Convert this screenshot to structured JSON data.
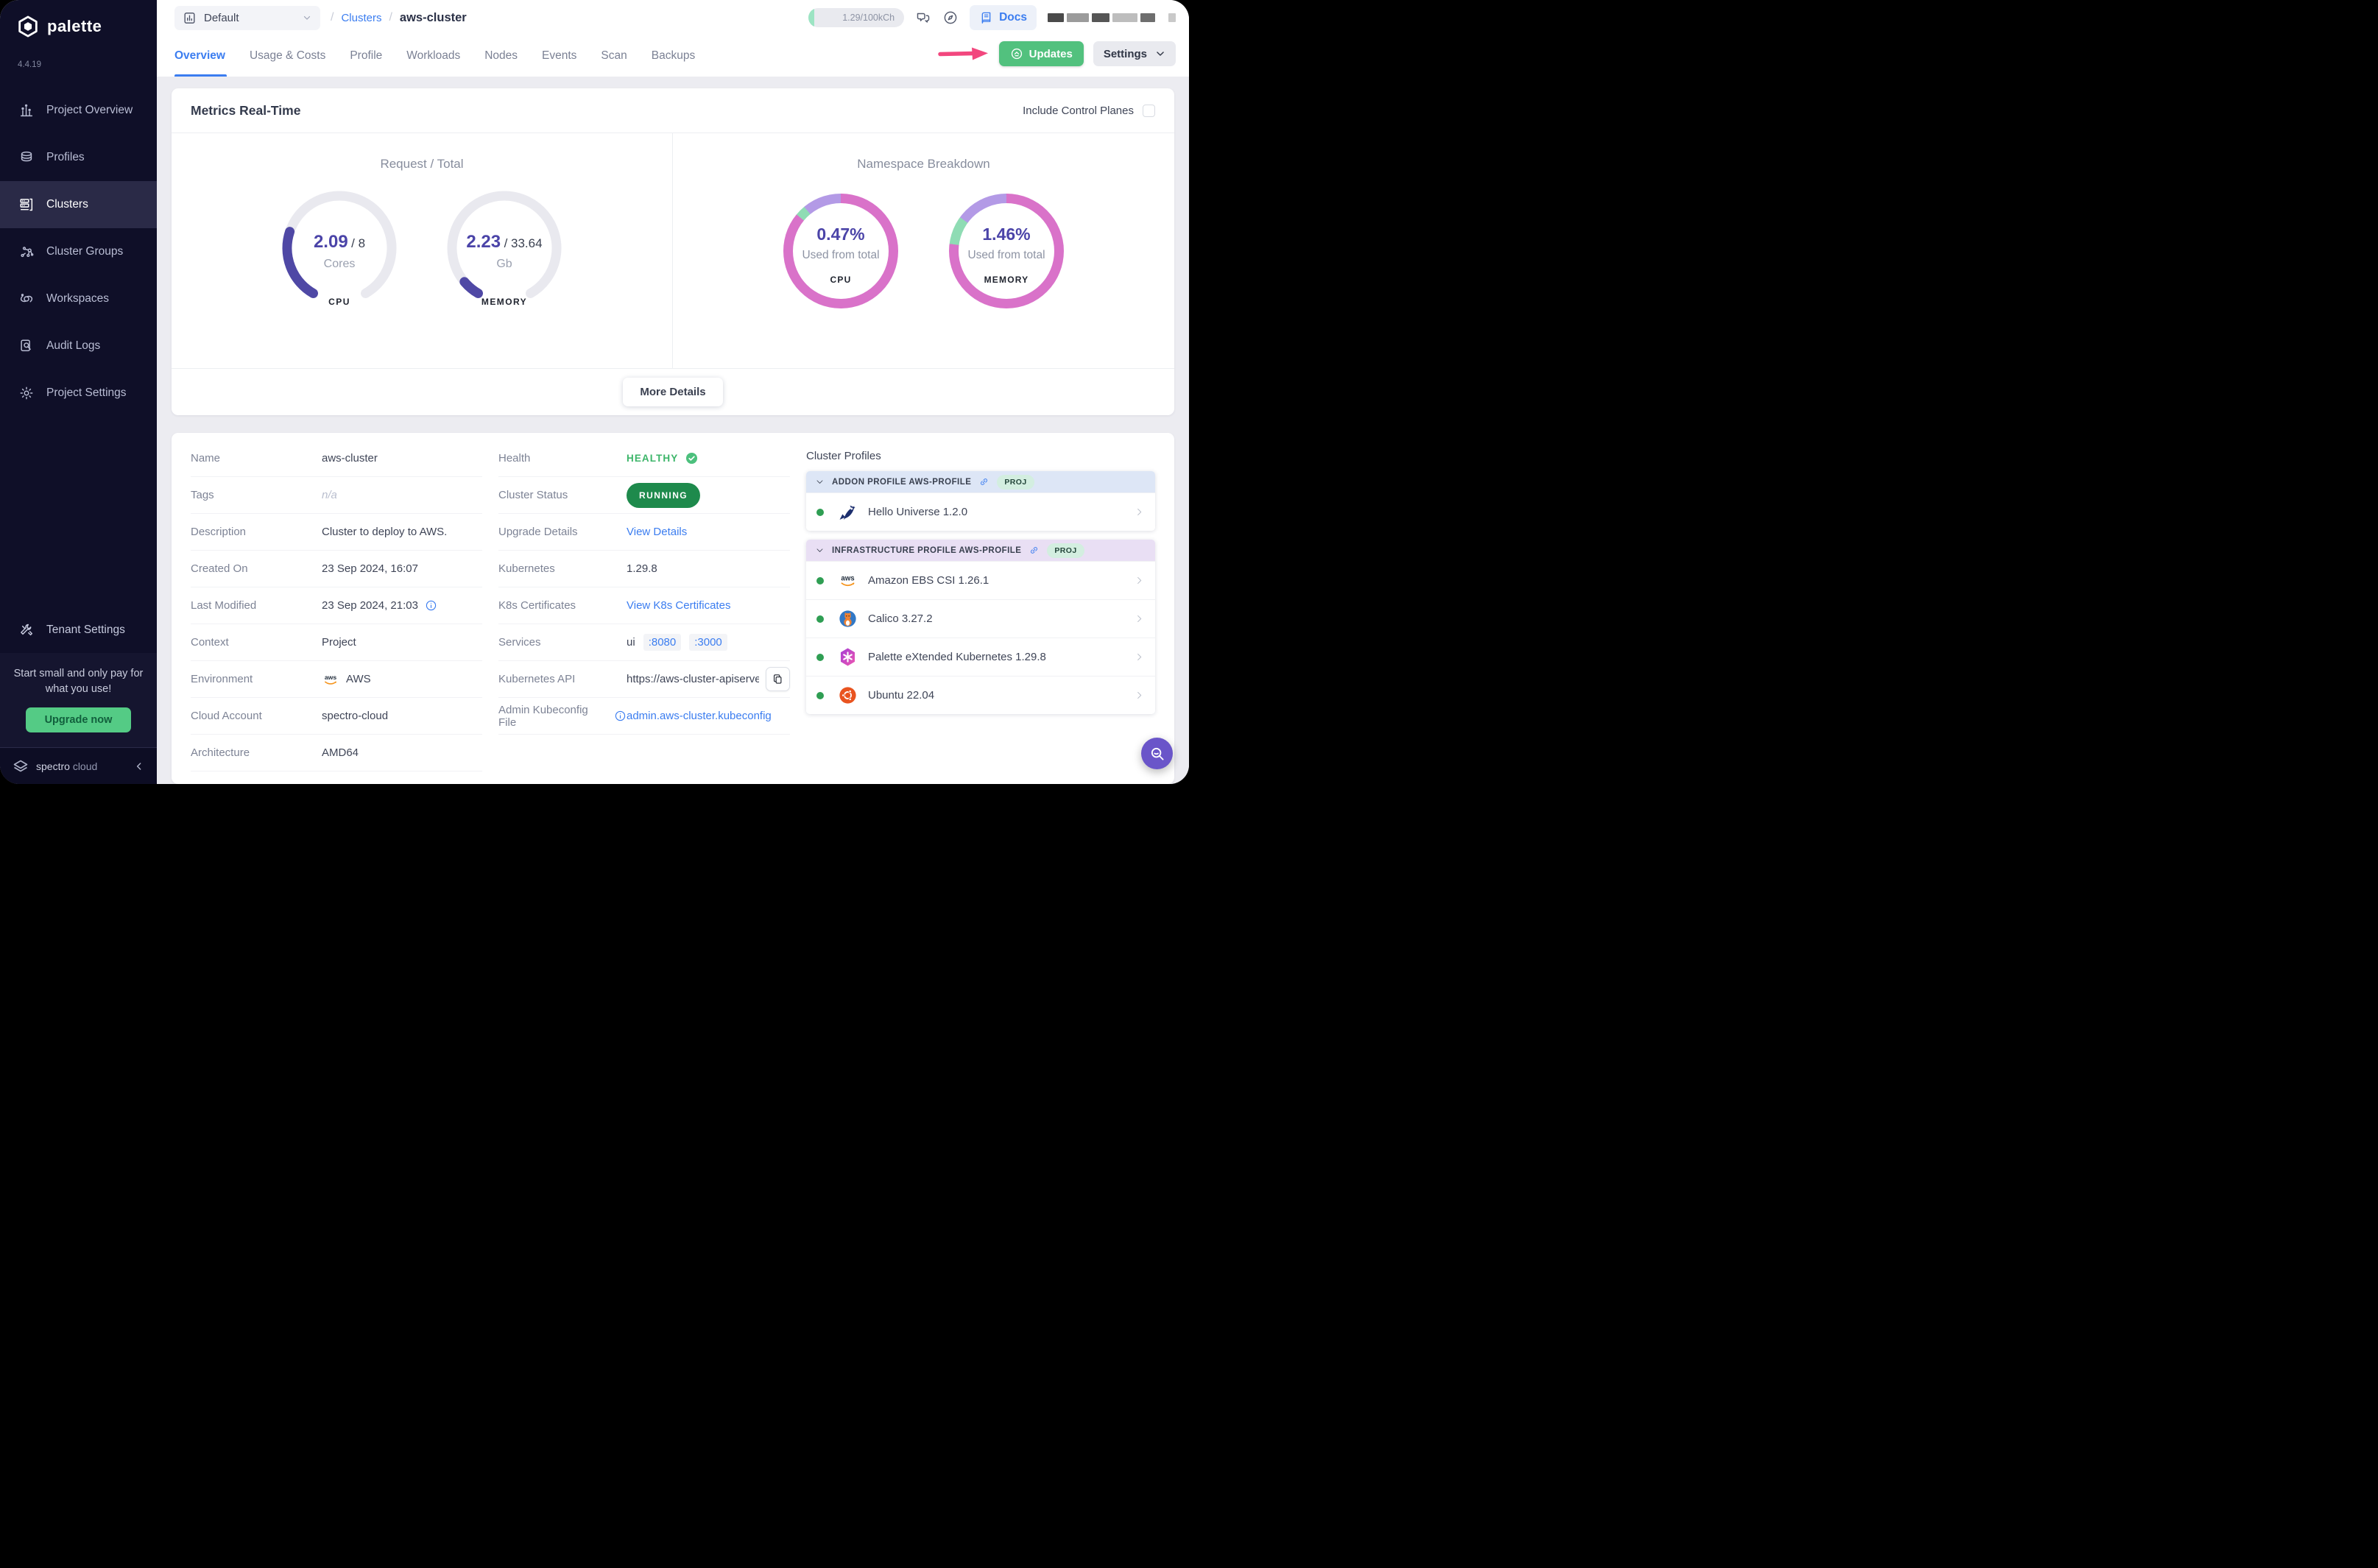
{
  "app": {
    "brand": "palette",
    "version": "4.4.19"
  },
  "sidebar": {
    "items": [
      {
        "label": "Project Overview",
        "icon": "chart-overview",
        "active": false
      },
      {
        "label": "Profiles",
        "icon": "layers",
        "active": false
      },
      {
        "label": "Clusters",
        "icon": "servers",
        "active": true
      },
      {
        "label": "Cluster Groups",
        "icon": "network",
        "active": false
      },
      {
        "label": "Workspaces",
        "icon": "orbit",
        "active": false
      },
      {
        "label": "Audit Logs",
        "icon": "audit",
        "active": false
      },
      {
        "label": "Project Settings",
        "icon": "gear",
        "active": false
      }
    ],
    "tenant_settings_label": "Tenant Settings",
    "promo": {
      "text": "Start small and only pay for what you use!",
      "button_label": "Upgrade now"
    },
    "footer": {
      "brand_strong": "spectro",
      "brand_light": "cloud"
    }
  },
  "topbar": {
    "project_selector_label": "Default",
    "breadcrumb": [
      {
        "label": "Clusters",
        "link": true
      },
      {
        "label": "aws-cluster",
        "link": false
      }
    ],
    "usage_pill": "1.29/100kCh",
    "docs_label": "Docs"
  },
  "tabs": [
    {
      "label": "Overview",
      "active": true
    },
    {
      "label": "Usage & Costs",
      "active": false
    },
    {
      "label": "Profile",
      "active": false
    },
    {
      "label": "Workloads",
      "active": false
    },
    {
      "label": "Nodes",
      "active": false
    },
    {
      "label": "Events",
      "active": false
    },
    {
      "label": "Scan",
      "active": false
    },
    {
      "label": "Backups",
      "active": false
    }
  ],
  "header_actions": {
    "updates_label": "Updates",
    "settings_label": "Settings"
  },
  "metrics": {
    "title": "Metrics Real-Time",
    "include_control_planes_label": "Include Control Planes",
    "gauge_color": "#4f48a5",
    "gauge_track": "#e9e9ef",
    "request_total": {
      "title": "Request / Total",
      "gauges": [
        {
          "value": "2.09",
          "total": "8",
          "unit": "Cores",
          "label": "CPU",
          "fraction": 0.261
        },
        {
          "value": "2.23",
          "total": "33.64",
          "unit": "Gb",
          "label": "MEMORY",
          "fraction": 0.066
        }
      ]
    },
    "namespace_breakdown": {
      "title": "Namespace Breakdown",
      "donuts": [
        {
          "value": "0.47%",
          "caption": "Used from total",
          "label": "CPU",
          "segments": [
            {
              "color": "#d972c9",
              "pct": 86
            },
            {
              "color": "#8fdcb4",
              "pct": 3
            },
            {
              "color": "#b39ae6",
              "pct": 11
            }
          ]
        },
        {
          "value": "1.46%",
          "caption": "Used from total",
          "label": "MEMORY",
          "segments": [
            {
              "color": "#d972c9",
              "pct": 77
            },
            {
              "color": "#8fdcb4",
              "pct": 8
            },
            {
              "color": "#b39ae6",
              "pct": 15
            }
          ]
        }
      ]
    },
    "more_details_label": "More Details"
  },
  "details": {
    "left": [
      {
        "label": "Name",
        "type": "text",
        "value": "aws-cluster"
      },
      {
        "label": "Tags",
        "type": "muted",
        "value": "n/a"
      },
      {
        "label": "Description",
        "type": "text",
        "value": "Cluster to deploy to AWS."
      },
      {
        "label": "Created On",
        "type": "text",
        "value": "23 Sep 2024, 16:07"
      },
      {
        "label": "Last Modified",
        "type": "text-info",
        "value": "23 Sep 2024, 21:03"
      },
      {
        "label": "Context",
        "type": "text",
        "value": "Project"
      },
      {
        "label": "Environment",
        "type": "aws",
        "value": "AWS"
      },
      {
        "label": "Cloud Account",
        "type": "text",
        "value": "spectro-cloud"
      },
      {
        "label": "Architecture",
        "type": "text",
        "value": "AMD64"
      }
    ],
    "mid": [
      {
        "label": "Health",
        "type": "health",
        "value": "HEALTHY"
      },
      {
        "label": "Cluster Status",
        "type": "badge",
        "value": "RUNNING"
      },
      {
        "label": "Upgrade Details",
        "type": "link",
        "value": "View Details"
      },
      {
        "label": "Kubernetes",
        "type": "text",
        "value": "1.29.8"
      },
      {
        "label": "K8s Certificates",
        "type": "link",
        "value": "View K8s Certificates"
      },
      {
        "label": "Services",
        "type": "services",
        "value": "ui",
        "ports": [
          ":8080",
          ":3000"
        ]
      },
      {
        "label": "Kubernetes API",
        "type": "copy",
        "value": "https://aws-cluster-apiserve..."
      },
      {
        "label": "Admin Kubeconfig File",
        "type": "link",
        "label_info": true,
        "value": "admin.aws-cluster.kubeconfig"
      }
    ]
  },
  "profiles": {
    "heading": "Cluster Profiles",
    "groups": [
      {
        "title": "ADDON PROFILE AWS-PROFILE",
        "badge": "PROJ",
        "tint": "blue",
        "items": [
          {
            "name": "Hello Universe 1.2.0",
            "icon": "hello-universe"
          }
        ]
      },
      {
        "title": "INFRASTRUCTURE PROFILE AWS-PROFILE",
        "badge": "PROJ",
        "tint": "purple",
        "items": [
          {
            "name": "Amazon EBS CSI 1.26.1",
            "icon": "aws"
          },
          {
            "name": "Calico 3.27.2",
            "icon": "calico"
          },
          {
            "name": "Palette eXtended Kubernetes 1.29.8",
            "icon": "pxk"
          },
          {
            "name": "Ubuntu 22.04",
            "icon": "ubuntu"
          }
        ]
      }
    ]
  },
  "colors": {
    "accent_blue": "#3b7df0",
    "green_button": "#52c17e",
    "running_badge": "#1e8a4c",
    "healthy_text": "#3cb569",
    "gauge_purple": "#4b44a8",
    "annotation_pink": "#f2477e",
    "sidebar_bg": "#0f0f28"
  }
}
